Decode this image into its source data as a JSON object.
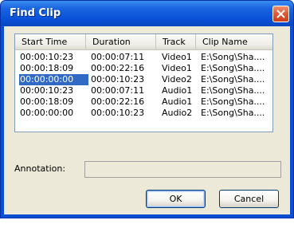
{
  "window": {
    "title": "Find Clip"
  },
  "list": {
    "columns": [
      "Start Time",
      "Duration",
      "Track",
      "Clip Name"
    ],
    "rows": [
      {
        "start": "00:00:10:23",
        "duration": "00:00:07:11",
        "track": "Video1",
        "clip": "E:\\Song\\Sha...."
      },
      {
        "start": "00:00:18:09",
        "duration": "00:00:22:16",
        "track": "Video1",
        "clip": "E:\\Song\\Sha...."
      },
      {
        "start": "00:00:00:00",
        "duration": "00:00:10:23",
        "track": "Video2",
        "clip": "E:\\Song\\Sha...."
      },
      {
        "start": "00:00:10:23",
        "duration": "00:00:07:11",
        "track": "Audio1",
        "clip": "E:\\Song\\Sha...."
      },
      {
        "start": "00:00:18:09",
        "duration": "00:00:22:16",
        "track": "Audio1",
        "clip": "E:\\Song\\Sha...."
      },
      {
        "start": "00:00:00:00",
        "duration": "00:00:10:23",
        "track": "Audio2",
        "clip": "E:\\Song\\Sha...."
      }
    ],
    "selected_index": 2
  },
  "annotation": {
    "label": "Annotation:",
    "value": ""
  },
  "buttons": {
    "ok": "OK",
    "cancel": "Cancel"
  },
  "colors": {
    "title_bar": "#0a52d8",
    "selection": "#316ac5",
    "dialog_bg": "#ece9d8",
    "close": "#e05830"
  },
  "icons": {
    "close": "close-icon"
  }
}
